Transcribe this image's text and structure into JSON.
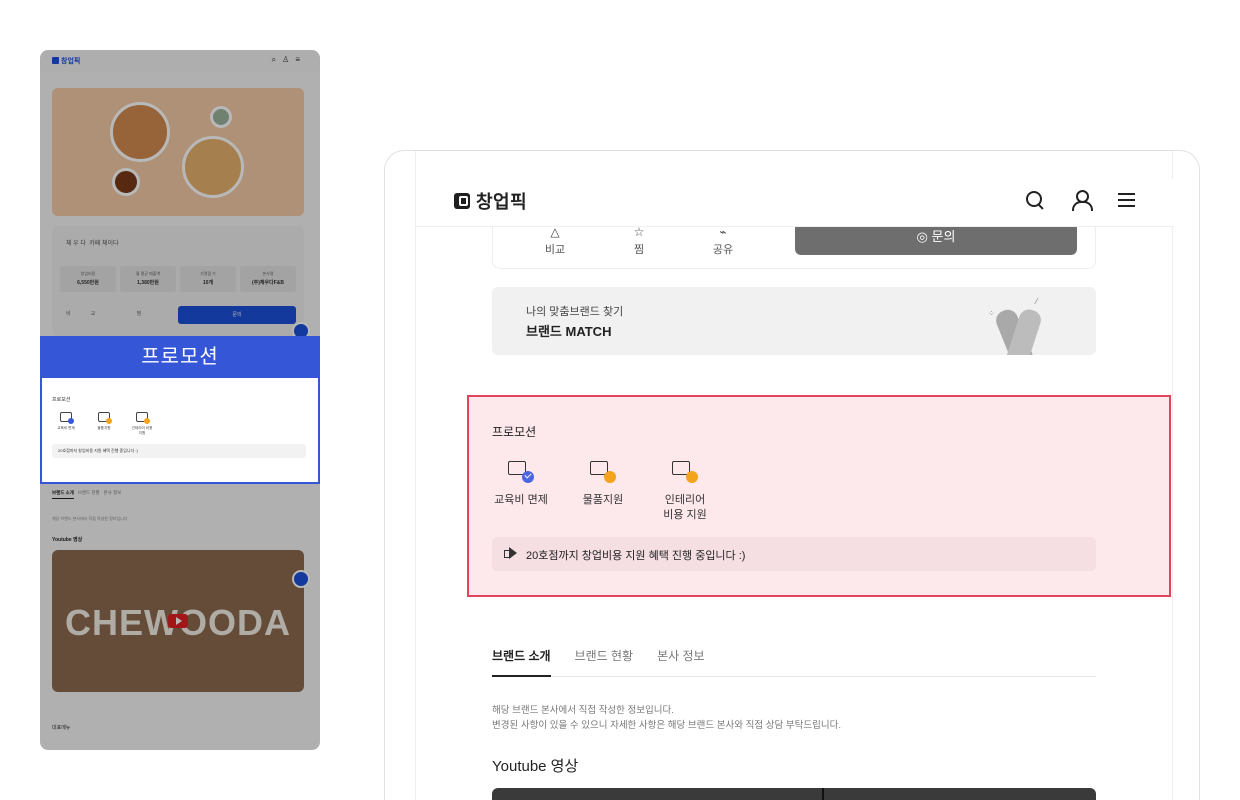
{
  "thumbnail": {
    "logo": "창업픽",
    "brand_name": "체 우 다",
    "brand_tag": "카페 체이다",
    "stats": [
      {
        "label": "창업비용",
        "value": "6,550만원"
      },
      {
        "label": "월 평균 매출액",
        "value": "1,380만원"
      },
      {
        "label": "가맹점 수",
        "value": "10개"
      },
      {
        "label": "본사명",
        "value": "(주)체우다F&B"
      }
    ],
    "actions": "비교 찜 공유",
    "inquiry": "문의",
    "promo_band": "프로모션",
    "promo_title": "프로모션",
    "promo_items": [
      "교육비 면제",
      "물품지원",
      "인테리어 비용 지원"
    ],
    "promo_bar": "20호점까지 창업비용 지원 혜택 진행 중입니다 :)",
    "tabs": [
      "브랜드 소개",
      "브랜드 현황",
      "본사 정보"
    ],
    "note": "해당 브랜드 본사에서 직접 작성한 정보입니다.",
    "youtube_heading": "Youtube 영상",
    "video_title": "CHEWOODA",
    "menu_heading": "대표메뉴"
  },
  "header": {
    "logo_text": "창업픽"
  },
  "actions": {
    "compare": "비교",
    "wish": "찜",
    "share": "공유",
    "inquiry": "문의"
  },
  "match": {
    "subtitle": "나의 맞춤브랜드 찾기",
    "title": "브랜드 MATCH"
  },
  "promotion": {
    "title": "프로모션",
    "items": [
      {
        "label": "교육비 면제"
      },
      {
        "label": "물품지원"
      },
      {
        "label": "인테리어",
        "label2": "비용 지원"
      }
    ],
    "notice": "20호점까지 창업비용 지원 혜택 진행 중입니다 :)"
  },
  "tabs": [
    "브랜드 소개",
    "브랜드 현황",
    "본사 정보"
  ],
  "intro": {
    "line1": "해당 브랜드 본사에서 직접 작성한 정보입니다.",
    "line2": "변경된 사항이 있을 수 있으니 자세한 사항은 해당 브랜드 본사와 직접 상담 부탁드립니다."
  },
  "youtube_heading": "Youtube 영상",
  "colors": {
    "highlight_border": "#e0455f",
    "highlight_fill": "#fde8ec",
    "brand_blue": "#1d4fd8",
    "promo_band": "#3656d8"
  }
}
